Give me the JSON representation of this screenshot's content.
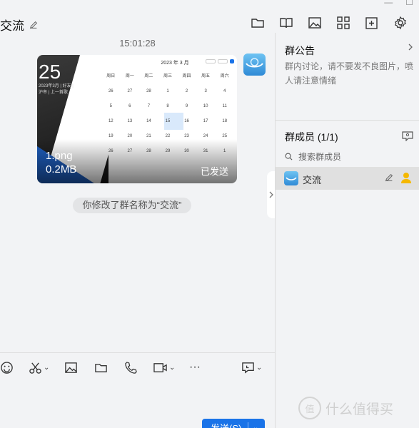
{
  "window": {
    "minimize_glyph": "—",
    "maximize_glyph": "☐"
  },
  "header": {
    "title": "交流",
    "icons": [
      "folder-icon",
      "book-icon",
      "image-icon",
      "grid-icon",
      "add-square-icon",
      "settings-icon"
    ]
  },
  "chat": {
    "timestamp": "15:01:28",
    "image_message": {
      "file_name": "1.png",
      "file_size": "0.2MB",
      "status": "已发送",
      "preview": {
        "big_day": "25",
        "small_text": "2023年3月 | 好友 | 沪市 | 上一首歌",
        "calendar_title": "2023 年 3 月",
        "weekdays": [
          "周日",
          "周一",
          "周二",
          "周三",
          "周四",
          "周五",
          "周六"
        ],
        "days": [
          "26",
          "27",
          "28",
          "1",
          "2",
          "3",
          "4",
          "5",
          "6",
          "7",
          "8",
          "9",
          "10",
          "11",
          "12",
          "13",
          "14",
          "15",
          "16",
          "17",
          "18",
          "19",
          "20",
          "21",
          "22",
          "23",
          "24",
          "25",
          "26",
          "27",
          "28",
          "29",
          "30",
          "31",
          "1"
        ]
      }
    },
    "system_message": "你修改了群名称为“交流”"
  },
  "composer": {
    "tools": [
      "emoji-icon",
      "scissors-icon",
      "image-icon",
      "folder-icon",
      "phone-icon",
      "video-icon",
      "more-icon",
      "history-icon"
    ],
    "more_glyph": "···",
    "send_label": "发送(S)",
    "dropdown_caret": "⌄"
  },
  "sidebar": {
    "notice": {
      "title": "群公告",
      "text": "群内讨论，请不要发不良图片，喷人请注意情绪"
    },
    "members": {
      "title": "群成员 (1/1)",
      "search_placeholder": "搜索群成员",
      "list": [
        {
          "name": "交流"
        }
      ]
    }
  },
  "watermark": {
    "logo_glyph": "值",
    "text": "什么值得买"
  }
}
